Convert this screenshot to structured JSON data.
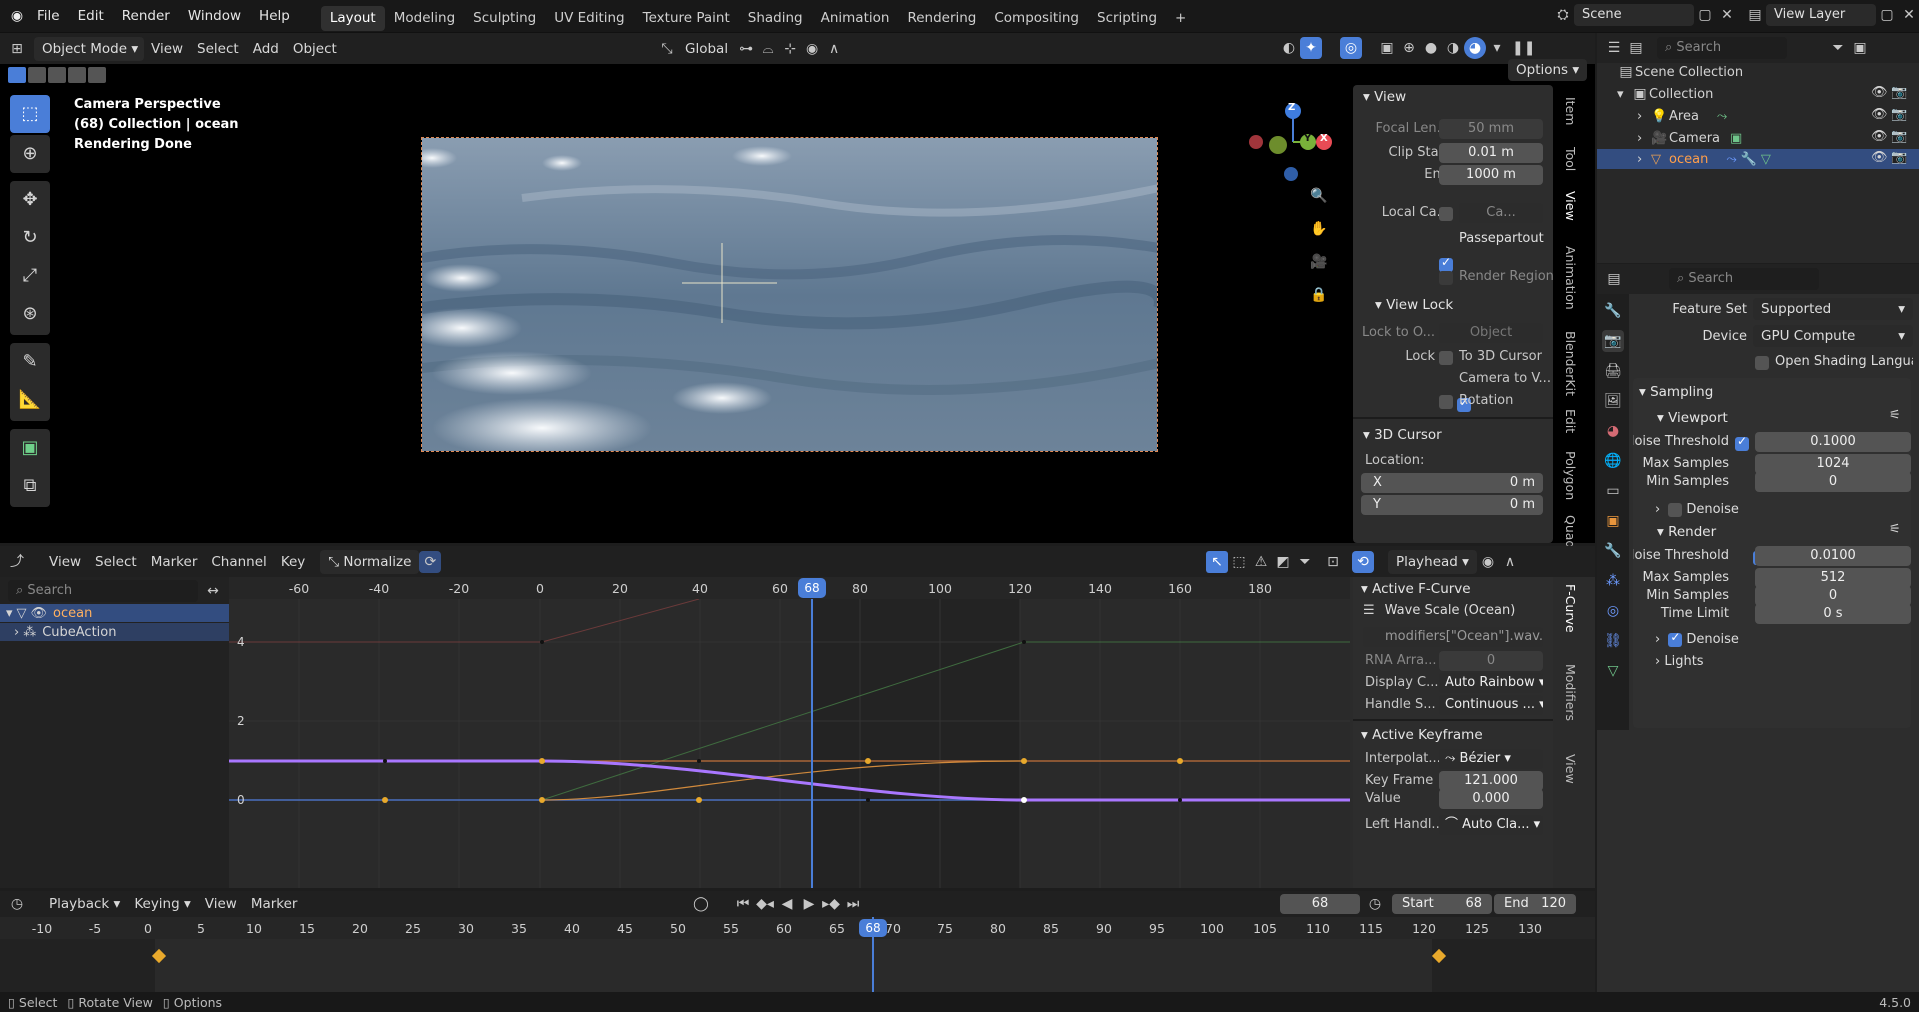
{
  "menu": {
    "file": "File",
    "edit": "Edit",
    "render": "Render",
    "window": "Window",
    "help": "Help"
  },
  "workspaces": [
    "Layout",
    "Modeling",
    "Sculpting",
    "UV Editing",
    "Texture Paint",
    "Shading",
    "Animation",
    "Rendering",
    "Compositing",
    "Scripting"
  ],
  "scene": {
    "scene_name": "Scene",
    "view_layer": "View Layer"
  },
  "viewport": {
    "mode": "Object Mode",
    "view": "View",
    "select": "Select",
    "add": "Add",
    "object": "Object",
    "orientation": "Global",
    "options": "Options",
    "overlay_line1": "Camera Perspective",
    "overlay_line2": "(68) Collection | ocean",
    "overlay_line3": "Rendering Done",
    "gizmo_z": "Z",
    "gizmo_y": "Y",
    "gizmo_x": "X"
  },
  "npanel": {
    "view_title": "View",
    "focal_label": "Focal Len...",
    "focal_value": "50 mm",
    "clip_start_label": "Clip Start",
    "clip_start_value": "0.01 m",
    "end_label": "End",
    "end_value": "1000 m",
    "local_cam_label": "Local Ca...",
    "local_cam_value": "Ca...",
    "passepartout": "Passepartout",
    "render_region": "Render Region",
    "view_lock_title": "View Lock",
    "lock_to_label": "Lock to O...",
    "lock_to_value": "Object",
    "lock_label": "Lock",
    "to_3d_cursor": "To 3D Cursor",
    "camera_to_view": "Camera to V...",
    "rotation": "Rotation",
    "cursor_title": "3D Cursor",
    "location_label": "Location:",
    "x_label": "X",
    "x_value": "0 m",
    "y_label": "Y",
    "y_value": "0 m",
    "tabs": [
      "Item",
      "Tool",
      "View",
      "Animation",
      "BlenderKit",
      "Edit",
      "Polygon",
      "Quad"
    ]
  },
  "outliner": {
    "search_placeholder": "Search",
    "scene_collection": "Scene Collection",
    "collection": "Collection",
    "items": [
      "Area",
      "Camera",
      "ocean"
    ]
  },
  "properties": {
    "search_placeholder": "Search",
    "feature_set_label": "Feature Set",
    "feature_set_value": "Supported",
    "device_label": "Device",
    "device_value": "GPU Compute",
    "osl_label": "Open Shading Language",
    "sampling": "Sampling",
    "viewport": "Viewport",
    "vp_noise_label": "Noise Threshold",
    "vp_noise_value": "0.1000",
    "vp_max_label": "Max Samples",
    "vp_max_value": "1024",
    "vp_min_label": "Min Samples",
    "vp_min_value": "0",
    "vp_denoise": "Denoise",
    "render": "Render",
    "r_noise_label": "Noise Threshold",
    "r_noise_value": "0.0100",
    "r_max_label": "Max Samples",
    "r_max_value": "512",
    "r_min_label": "Min Samples",
    "r_min_value": "0",
    "r_time_label": "Time Limit",
    "r_time_value": "0 s",
    "r_denoise": "Denoise",
    "lights": "Lights"
  },
  "graph": {
    "view": "View",
    "select": "Select",
    "marker": "Marker",
    "channel": "Channel",
    "key": "Key",
    "normalize": "Normalize",
    "pivot": "Playhead",
    "search_placeholder": "Search",
    "channels": [
      "ocean",
      "CubeAction"
    ],
    "x_ticks": [
      "-60",
      "-40",
      "-20",
      "0",
      "20",
      "40",
      "60",
      "80",
      "100",
      "120",
      "140",
      "160",
      "180"
    ],
    "y_ticks": [
      "4",
      "2",
      "0"
    ],
    "current_frame": "68",
    "sidebar": {
      "active_fcurve": "Active F-Curve",
      "fcurve_name": "Wave Scale (Ocean)",
      "data_path": "modifiers[\"Ocean\"].wav...",
      "rna_label": "RNA Arra...",
      "rna_value": "0",
      "display_color_label": "Display C...",
      "display_color_value": "Auto Rainbow",
      "handle_label": "Handle S...",
      "handle_value": "Continuous ...",
      "active_keyframe": "Active Keyframe",
      "interp_label": "Interpolat...",
      "interp_value": "Bézier",
      "keyframe_label": "Key Frame",
      "keyframe_value": "121.000",
      "value_label": "Value",
      "value_value": "0.000",
      "left_handle_label": "Left Handl...",
      "left_handle_value": "Auto Cla...",
      "tabs": [
        "F-Curve",
        "Modifiers",
        "View"
      ]
    }
  },
  "timeline": {
    "playback": "Playback",
    "keying": "Keying",
    "view": "View",
    "marker": "Marker",
    "current_frame": "68",
    "start_label": "Start",
    "start_value": "68",
    "end_label": "End",
    "end_value": "120",
    "ticks": [
      "-10",
      "-5",
      "0",
      "5",
      "10",
      "15",
      "20",
      "25",
      "30",
      "35",
      "40",
      "45",
      "50",
      "55",
      "60",
      "65",
      "70",
      "75",
      "80",
      "85",
      "90",
      "95",
      "100",
      "105",
      "110",
      "115",
      "120",
      "125",
      "130"
    ],
    "playhead": "68"
  },
  "status": {
    "select": "Select",
    "rotate": "Rotate View",
    "options": "Options",
    "version": "4.5.0"
  },
  "colors": {
    "accent": "#4a7ed8",
    "playhead": "#4a7ed8",
    "curve_purple": "#a977ff",
    "curve_orange": "#d18a3c",
    "keyframe": "#e8a92c"
  }
}
